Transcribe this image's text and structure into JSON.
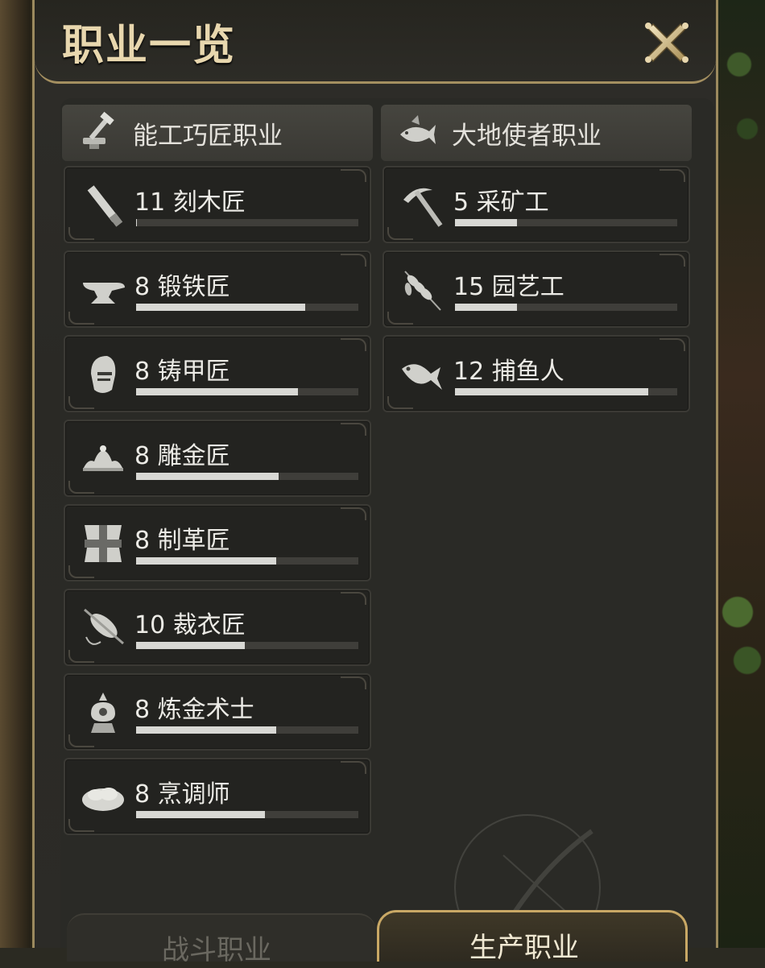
{
  "window": {
    "title": "职业一览"
  },
  "columns": [
    {
      "header": "能工巧匠职业",
      "icon": "crafter-hammer-icon"
    },
    {
      "header": "大地使者职业",
      "icon": "gatherer-fish-icon"
    }
  ],
  "crafters": [
    {
      "level": "11",
      "name": "刻木匠",
      "progress": 0.005,
      "icon": "saw-icon"
    },
    {
      "level": "8",
      "name": "锻铁匠",
      "progress": 0.76,
      "icon": "anvil-icon"
    },
    {
      "level": "8",
      "name": "铸甲匠",
      "progress": 0.73,
      "icon": "helmet-icon"
    },
    {
      "level": "8",
      "name": "雕金匠",
      "progress": 0.64,
      "icon": "tiara-icon"
    },
    {
      "level": "8",
      "name": "制革匠",
      "progress": 0.63,
      "icon": "leather-icon"
    },
    {
      "level": "10",
      "name": "裁衣匠",
      "progress": 0.49,
      "icon": "spindle-icon"
    },
    {
      "level": "8",
      "name": "炼金术士",
      "progress": 0.63,
      "icon": "alembic-icon"
    },
    {
      "level": "8",
      "name": "烹调师",
      "progress": 0.58,
      "icon": "bread-icon"
    }
  ],
  "gatherers": [
    {
      "level": "5",
      "name": "采矿工",
      "progress": 0.28,
      "icon": "pickaxe-icon"
    },
    {
      "level": "15",
      "name": "园艺工",
      "progress": 0.28,
      "icon": "wheat-icon"
    },
    {
      "level": "12",
      "name": "捕鱼人",
      "progress": 0.87,
      "icon": "fish-icon"
    }
  ],
  "tabs": {
    "combat": "战斗职业",
    "production": "生产职业"
  },
  "colors": {
    "accent_gold": "#c9a865",
    "bar_fill": "#d8d8d4",
    "bar_bg": "#3f3e3a"
  }
}
